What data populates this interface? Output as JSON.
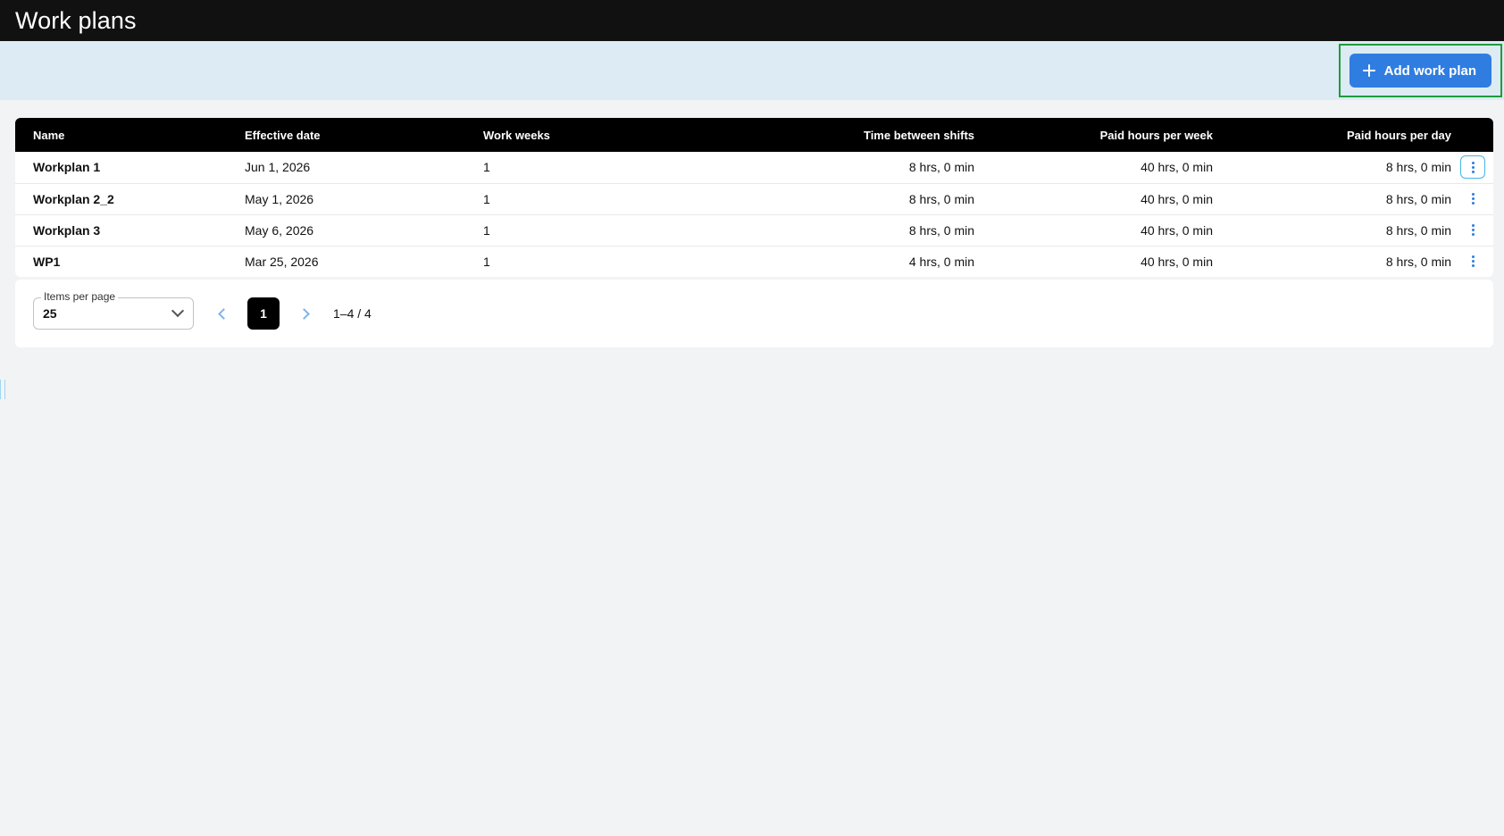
{
  "header": {
    "title": "Work plans"
  },
  "actions": {
    "add_label": "Add work plan"
  },
  "table": {
    "columns": {
      "name": "Name",
      "effective_date": "Effective date",
      "work_weeks": "Work weeks",
      "time_between_shifts": "Time between shifts",
      "paid_hours_week": "Paid hours per week",
      "paid_hours_day": "Paid hours per day"
    },
    "rows": [
      {
        "name": "Workplan 1",
        "effective_date": "Jun 1, 2026",
        "work_weeks": "1",
        "time_between_shifts": "8 hrs, 0 min",
        "paid_hours_week": "40 hrs, 0 min",
        "paid_hours_day": "8 hrs, 0 min"
      },
      {
        "name": "Workplan 2_2",
        "effective_date": "May 1, 2026",
        "work_weeks": "1",
        "time_between_shifts": "8 hrs, 0 min",
        "paid_hours_week": "40 hrs, 0 min",
        "paid_hours_day": "8 hrs, 0 min"
      },
      {
        "name": "Workplan 3",
        "effective_date": "May 6, 2026",
        "work_weeks": "1",
        "time_between_shifts": "8 hrs, 0 min",
        "paid_hours_week": "40 hrs, 0 min",
        "paid_hours_day": "8 hrs, 0 min"
      },
      {
        "name": "WP1",
        "effective_date": "Mar 25, 2026",
        "work_weeks": "1",
        "time_between_shifts": "4 hrs, 0 min",
        "paid_hours_week": "40 hrs, 0 min",
        "paid_hours_day": "8 hrs, 0 min"
      }
    ]
  },
  "pagination": {
    "items_per_page_label": "Items per page",
    "items_per_page_value": "25",
    "current_page": "1",
    "range_text": "1–4 / 4"
  },
  "colors": {
    "primary": "#2f7de1",
    "header_bg": "#111111",
    "action_bar_bg": "#ddebf4",
    "focus_outline": "#1f9c3a"
  }
}
